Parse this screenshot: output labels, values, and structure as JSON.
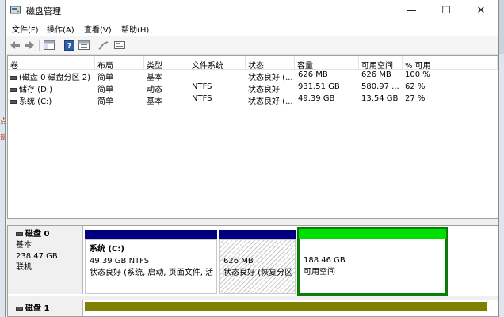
{
  "window": {
    "title": "磁盘管理"
  },
  "menu": [
    "文件(F)",
    "操作(A)",
    "查看(V)",
    "帮助(H)"
  ],
  "columns": [
    "卷",
    "布局",
    "类型",
    "文件系统",
    "状态",
    "容量",
    "可用空间",
    "% 可用"
  ],
  "volumes": [
    {
      "name": "(磁盘 0 磁盘分区 2)",
      "layout": "简单",
      "type": "基本",
      "fs": "",
      "status": "状态良好 (...",
      "capacity": "626 MB",
      "free": "626 MB",
      "pct": "100 %"
    },
    {
      "name": "储存 (D:)",
      "layout": "简单",
      "type": "动态",
      "fs": "NTFS",
      "status": "状态良好",
      "capacity": "931.51 GB",
      "free": "580.97 ...",
      "pct": "62 %"
    },
    {
      "name": "系统 (C:)",
      "layout": "简单",
      "type": "基本",
      "fs": "NTFS",
      "status": "状态良好 (...",
      "capacity": "49.39 GB",
      "free": "13.54 GB",
      "pct": "27 %"
    }
  ],
  "disks": [
    {
      "name": "磁盘 0",
      "type": "基本",
      "size": "238.47 GB",
      "state": "联机",
      "partitions": [
        {
          "title": "系统  (C:)",
          "line1": "49.39 GB NTFS",
          "line2": "状态良好 (系统, 启动, 页面文件, 活"
        },
        {
          "title": "",
          "line1": "626 MB",
          "line2": "状态良好 (恢复分区"
        },
        {
          "title": "",
          "line1": "188.46 GB",
          "line2": "可用空间"
        }
      ]
    },
    {
      "name": "磁盘 1"
    }
  ],
  "colors": {
    "primary_partition_bar": "#000080",
    "unallocated_bar": "#00e000",
    "selected_border": "#0a7c0a",
    "dynamic_volume_bar": "#808000"
  },
  "left_edge_marks": [
    "点",
    "部"
  ]
}
